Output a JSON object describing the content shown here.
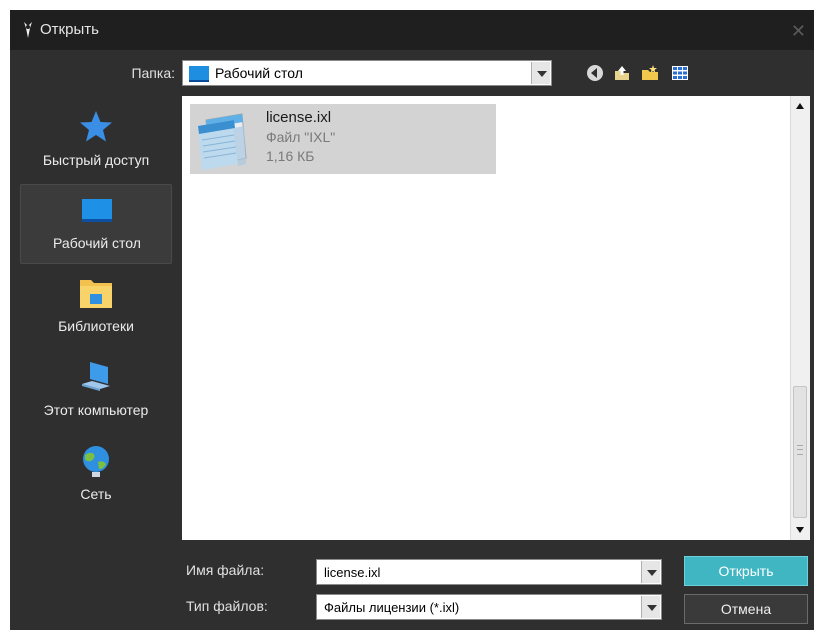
{
  "window": {
    "title": "Открыть",
    "title_icon": "app-icon",
    "close_icon": "close-icon"
  },
  "toolbar": {
    "folder_label": "Папка:",
    "folder_value": "Рабочий стол",
    "folder_icon": "desktop-icon",
    "buttons": [
      "back-icon",
      "up-folder-icon",
      "new-folder-icon",
      "view-menu-icon"
    ]
  },
  "places": [
    {
      "label": "Быстрый доступ",
      "icon": "star-icon"
    },
    {
      "label": "Рабочий стол",
      "icon": "desktop-icon",
      "selected": true
    },
    {
      "label": "Библиотеки",
      "icon": "libraries-icon"
    },
    {
      "label": "Этот компьютер",
      "icon": "computer-icon"
    },
    {
      "label": "Сеть",
      "icon": "network-icon"
    }
  ],
  "files": [
    {
      "name": "license.ixl",
      "type": "Файл \"IXL\"",
      "size": "1,16 КБ",
      "icon": "notepad-file-icon",
      "selected": true
    }
  ],
  "form": {
    "file_name_label": "Имя файла:",
    "file_name_value": "license.ixl",
    "file_type_label": "Тип файлов:",
    "file_type_value": "Файлы лицензии (*.ixl)"
  },
  "buttons": {
    "open": "Открыть",
    "cancel": "Отмена"
  },
  "colors": {
    "dialog_bg": "#2f2f2f",
    "accent_open_button": "#3fb6c2",
    "selection_bg": "#d3d3d3"
  }
}
